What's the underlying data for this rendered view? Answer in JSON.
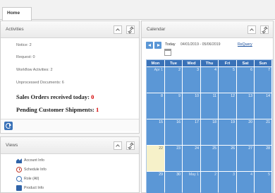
{
  "tabs": [
    {
      "label": "Home"
    }
  ],
  "activities": {
    "title": "Activities",
    "lines": [
      "Notice: 2",
      "Request: 0",
      "Workflow Activities: 2",
      "Unprocessed Documents: 6"
    ],
    "sales_orders_label": "Sales Orders received today: ",
    "sales_orders_count": "0",
    "pending_shipments_label": "Pending Customer Shipments: ",
    "pending_shipments_count": "1"
  },
  "views": {
    "title": "Views",
    "items": [
      {
        "label": "Account Info",
        "icon": "chart-icon"
      },
      {
        "label": "Schedule Info",
        "icon": "clock-icon"
      },
      {
        "label": "Role (All)",
        "icon": "magnifier-icon"
      },
      {
        "label": "Product Info",
        "icon": "box-icon"
      }
    ]
  },
  "calendar": {
    "title": "Calendar",
    "today_label": "Today",
    "date_range": "04/01/2019 - 05/06/2019",
    "requery_label": "ReQuery",
    "day_headers": [
      "Mon",
      "Tue",
      "Wed",
      "Thu",
      "Fri",
      "Sat",
      "Sun"
    ],
    "weeks": [
      [
        "Apr 1",
        "2",
        "3",
        "4",
        "5",
        "6",
        "7"
      ],
      [
        "8",
        "9",
        "10",
        "11",
        "12",
        "13",
        "14"
      ],
      [
        "15",
        "16",
        "17",
        "18",
        "19",
        "20",
        "21"
      ],
      [
        "22",
        "23",
        "24",
        "25",
        "26",
        "27",
        "28"
      ],
      [
        "29",
        "30",
        "May 1",
        "2",
        "3",
        "4",
        "5"
      ]
    ],
    "today_cell": [
      3,
      0
    ],
    "colors": {
      "header": "#3a72b8",
      "day_cell": "#5b97d6",
      "today_cell": "#f6f1c9",
      "link": "#1a4f9c",
      "count_red": "#d40000"
    }
  }
}
